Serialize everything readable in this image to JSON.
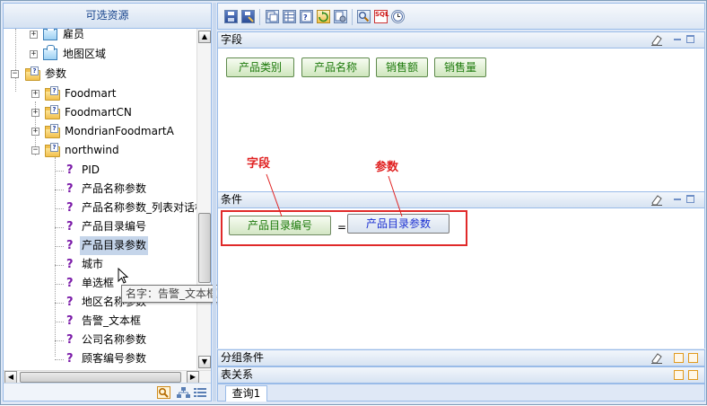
{
  "left_panel": {
    "title": "可选资源",
    "tree": [
      {
        "label": "雇员",
        "icon": "table-icon"
      },
      {
        "label": "地图区域",
        "icon": "table-icon"
      },
      {
        "label": "参数",
        "icon": "param-folder-icon"
      },
      {
        "label": "Foodmart",
        "icon": "param-folder-icon"
      },
      {
        "label": "FoodmartCN",
        "icon": "param-folder-icon"
      },
      {
        "label": "MondrianFoodmartA",
        "icon": "param-folder-icon"
      },
      {
        "label": "northwind",
        "icon": "param-folder-icon"
      },
      {
        "label": "PID",
        "icon": "param-icon"
      },
      {
        "label": "产品名称参数",
        "icon": "param-icon"
      },
      {
        "label": "产品名称参数_列表对话框",
        "icon": "param-icon"
      },
      {
        "label": "产品目录编号",
        "icon": "param-icon"
      },
      {
        "label": "产品目录参数",
        "icon": "param-icon",
        "selected": true
      },
      {
        "label": "城市",
        "icon": "param-icon"
      },
      {
        "label": "单选框",
        "icon": "param-icon"
      },
      {
        "label": "地区名称参数",
        "icon": "param-icon"
      },
      {
        "label": "告警_文本框",
        "icon": "param-icon"
      },
      {
        "label": "公司名称参数",
        "icon": "param-icon"
      },
      {
        "label": "顾客编号参数",
        "icon": "param-icon"
      }
    ],
    "tooltip": "名字：告警_文本框"
  },
  "panels": {
    "fields": {
      "title": "字段",
      "buttons": [
        "产品类别",
        "产品名称",
        "销售额",
        "销售量"
      ]
    },
    "conditions": {
      "title": "条件",
      "left_operand": "产品目录编号",
      "operator": "=",
      "right_operand": "产品目录参数"
    },
    "group_conditions": {
      "title": "分组条件"
    },
    "table_relations": {
      "title": "表关系"
    }
  },
  "annotations": {
    "field_label": "字段",
    "param_label": "参数",
    "color": "#e02020"
  },
  "bottom_tab": {
    "label": "查询1"
  },
  "toolbar": {
    "sql_label": "SQL",
    "icons": [
      "save-icon",
      "save-as-icon",
      "copy-icon",
      "table-view-icon",
      "param-icon",
      "refresh-icon",
      "settings-icon",
      "search-icon",
      "sql-icon",
      "clock-icon"
    ]
  },
  "colors": {
    "frame_border": "#99bbe8",
    "field_text": "#1d7a0c",
    "param_text": "#1a2fd1",
    "selected_bg": "#c5d5ea"
  }
}
